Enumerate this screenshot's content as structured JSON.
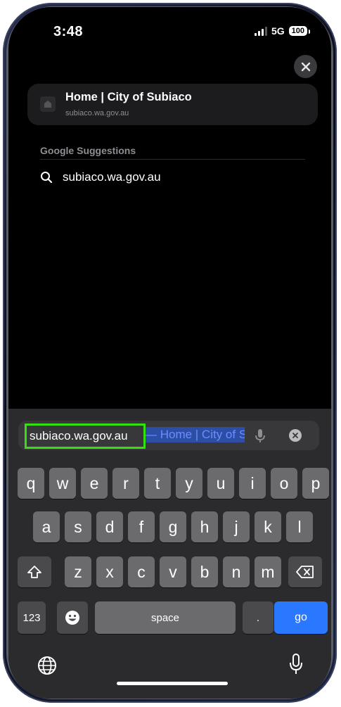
{
  "status_bar": {
    "time": "3:48",
    "network": "5G",
    "battery": "100"
  },
  "top_hit": {
    "title": "Home | City of Subiaco",
    "url": "subiaco.wa.gov.au"
  },
  "suggestions": {
    "header": "Google Suggestions",
    "items": [
      {
        "text": "subiaco.wa.gov.au",
        "icon": "search-icon"
      }
    ]
  },
  "url_bar": {
    "typed": "subiaco.wa.gov.au",
    "autofill": " — Home | City of Subiaco",
    "highlight_color": "#34e00e"
  },
  "keyboard": {
    "row1": [
      "q",
      "w",
      "e",
      "r",
      "t",
      "y",
      "u",
      "i",
      "o",
      "p"
    ],
    "row2": [
      "a",
      "s",
      "d",
      "f",
      "g",
      "h",
      "j",
      "k",
      "l"
    ],
    "row3": [
      "z",
      "x",
      "c",
      "v",
      "b",
      "n",
      "m"
    ],
    "numbers_label": "123",
    "space_label": "space",
    "period_label": ".",
    "go_label": "go"
  },
  "colors": {
    "accent": "#2a78ff",
    "autofill_bg": "#2e4ea6",
    "autofill_text": "#6a8dff"
  }
}
